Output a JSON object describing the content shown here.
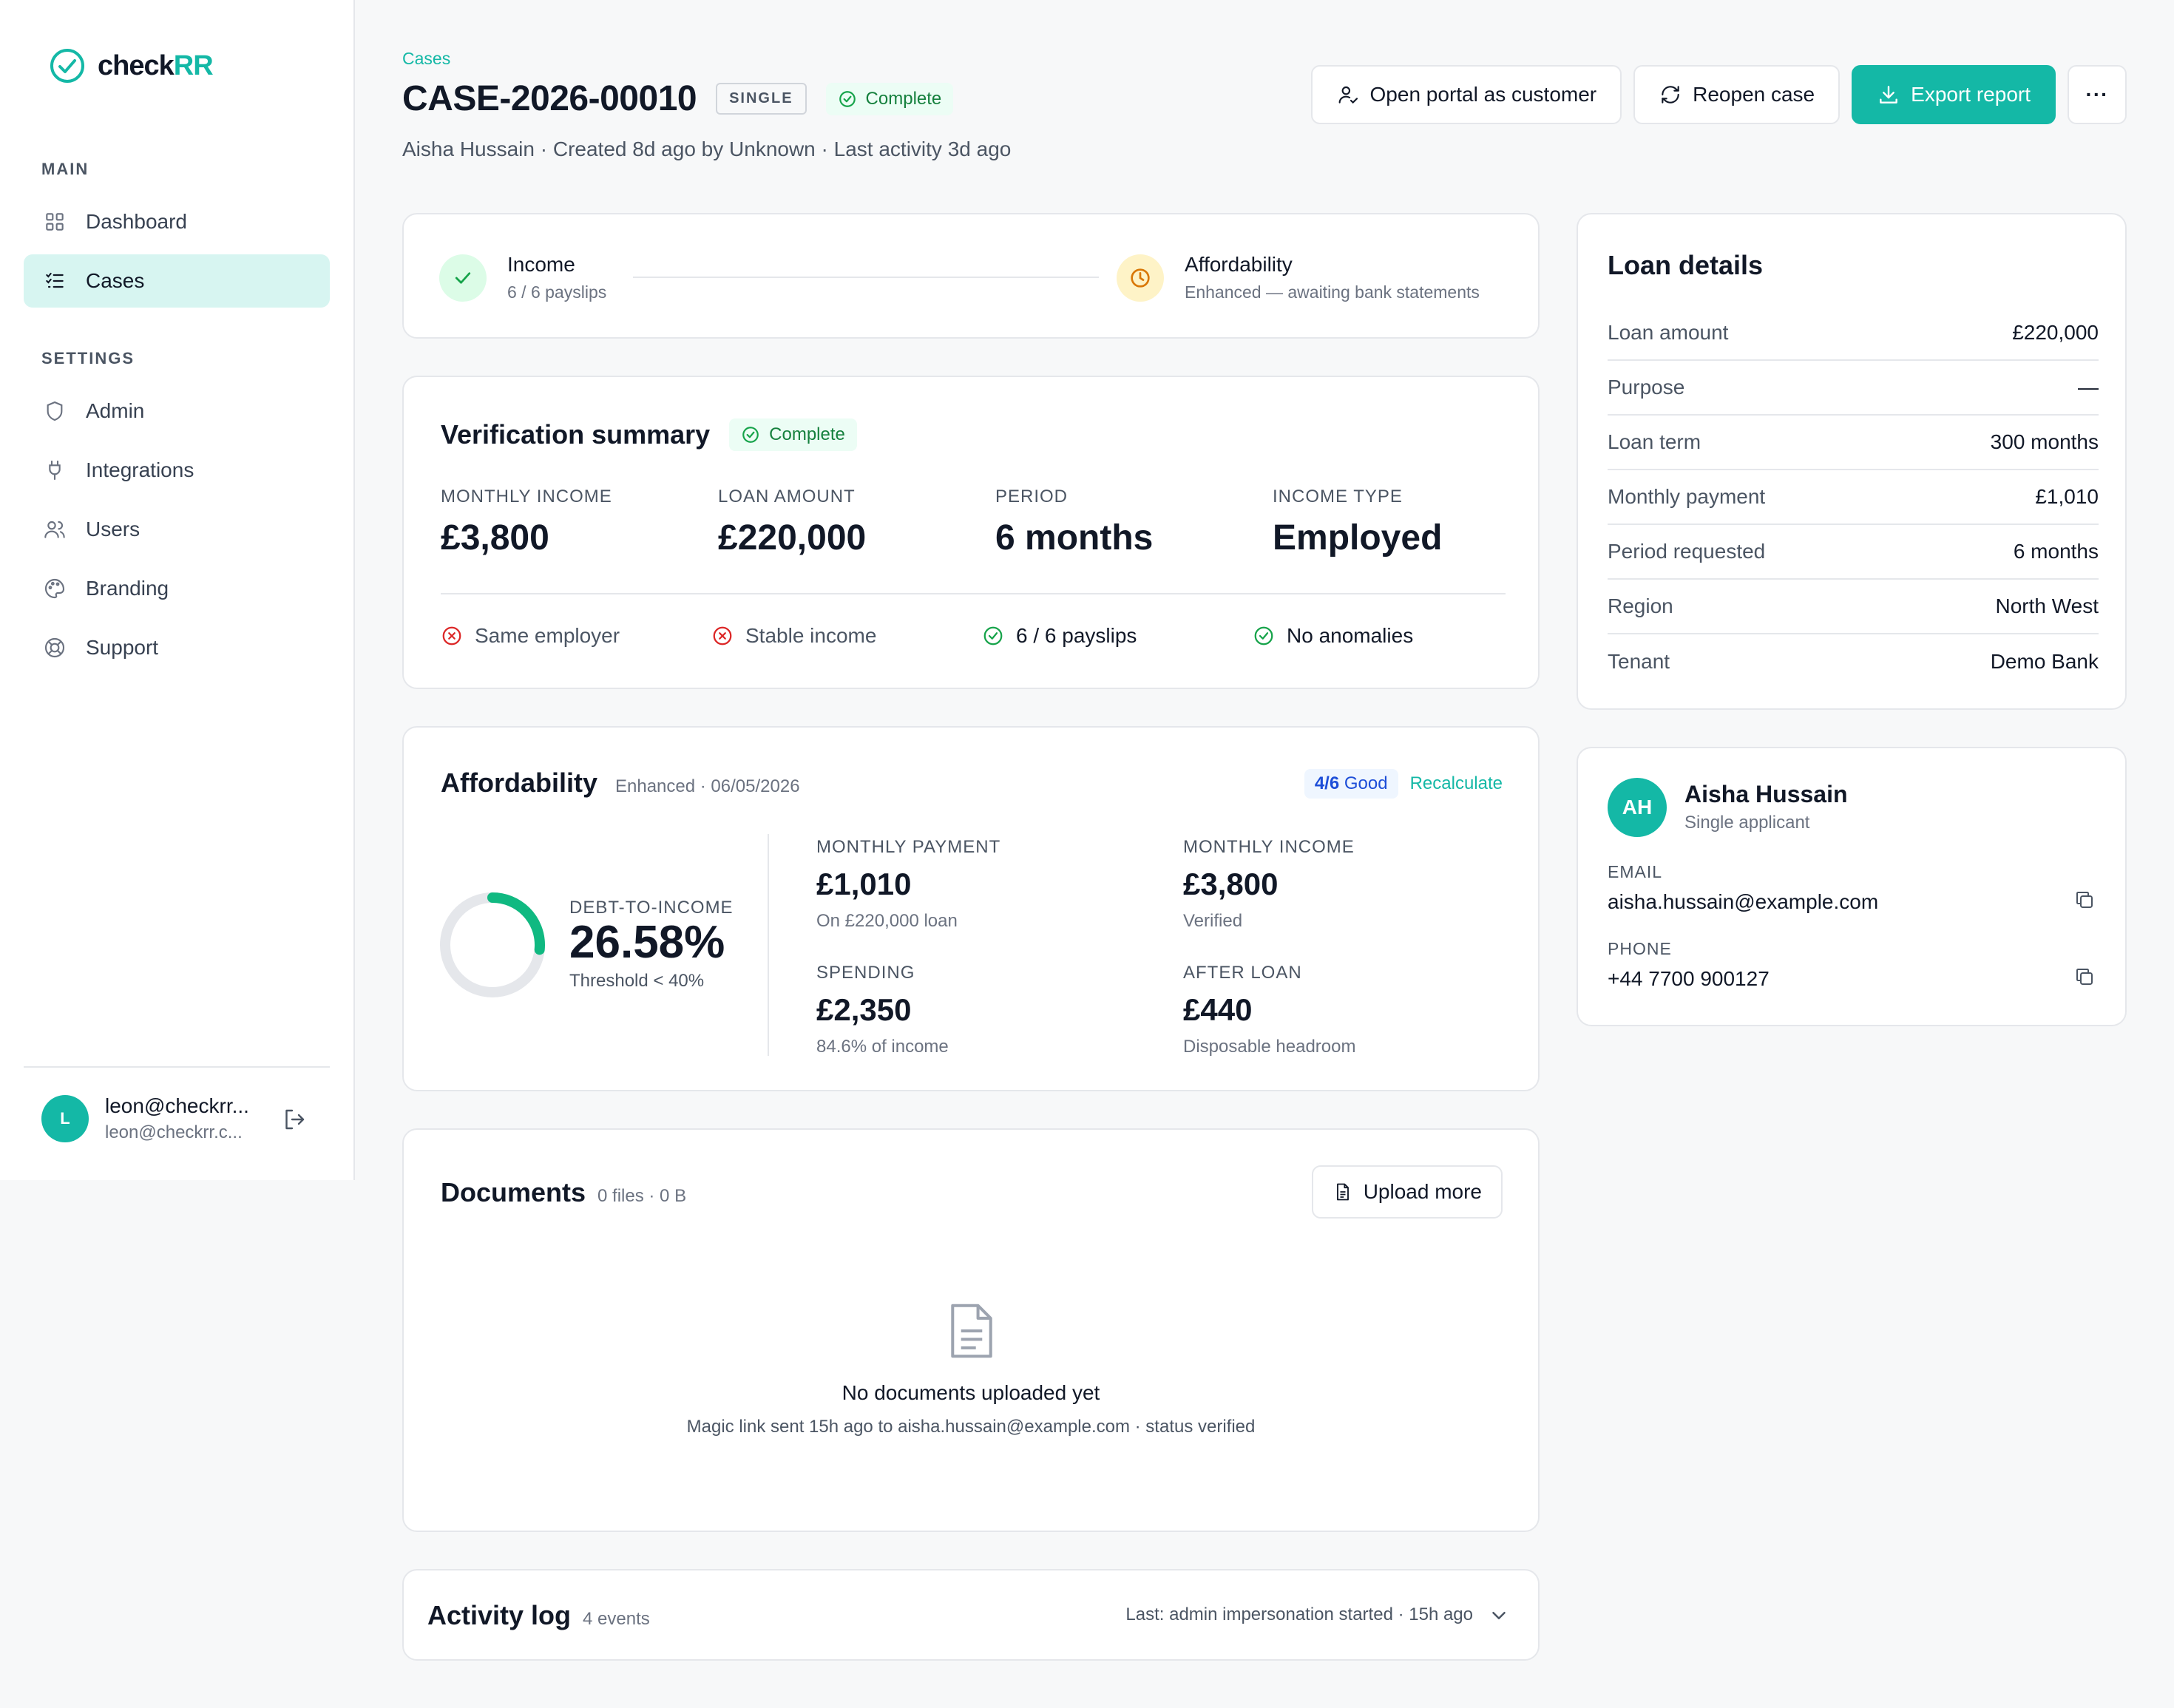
{
  "app": {
    "logo_main": "check",
    "logo_accent": "RR"
  },
  "sidebar": {
    "section_main": "MAIN",
    "section_settings": "SETTINGS",
    "items": [
      {
        "label": "Dashboard",
        "icon": "grid-icon"
      },
      {
        "label": "Cases",
        "icon": "list-check-icon",
        "active": true
      },
      {
        "label": "Admin",
        "icon": "shield-icon"
      },
      {
        "label": "Integrations",
        "icon": "plug-icon"
      },
      {
        "label": "Users",
        "icon": "users-icon"
      },
      {
        "label": "Branding",
        "icon": "palette-icon"
      },
      {
        "label": "Support",
        "icon": "lifebuoy-icon"
      }
    ],
    "user": {
      "initial": "L",
      "name": "leon@checkrr...",
      "email": "leon@checkrr.c..."
    }
  },
  "header": {
    "breadcrumb": "Cases",
    "title": "CASE-2026-00010",
    "tag": "SINGLE",
    "status": "Complete",
    "subline": "Aisha Hussain · Created 8d ago by Unknown · Last activity 3d ago",
    "actions": {
      "portal": "Open portal as customer",
      "reopen": "Reopen case",
      "export": "Export report",
      "more": "···"
    }
  },
  "steps": {
    "income_title": "Income",
    "income_sub": "6 / 6 payslips",
    "afford_title": "Affordability",
    "afford_sub": "Enhanced — awaiting bank statements"
  },
  "verification": {
    "title": "Verification summary",
    "status": "Complete",
    "stats": [
      {
        "label": "MONTHLY INCOME",
        "value": "£3,800"
      },
      {
        "label": "LOAN AMOUNT",
        "value": "£220,000"
      },
      {
        "label": "PERIOD",
        "value": "6 months"
      },
      {
        "label": "INCOME TYPE",
        "value": "Employed"
      }
    ],
    "checks": [
      {
        "label": "Same employer",
        "ok": false
      },
      {
        "label": "Stable income",
        "ok": false
      },
      {
        "label": "6 / 6 payslips",
        "ok": true
      },
      {
        "label": "No anomalies",
        "ok": true
      }
    ]
  },
  "affordability": {
    "title": "Affordability",
    "meta": "Enhanced · 06/05/2026",
    "score": "4/6",
    "score_label": "Good",
    "recalc": "Recalculate",
    "dti_label": "DEBT-TO-INCOME",
    "dti_value": "26.58%",
    "dti_fraction": 0.2658,
    "dti_threshold": "Threshold < 40%",
    "stats": [
      {
        "label": "MONTHLY PAYMENT",
        "value": "£1,010",
        "sub": "On £220,000 loan"
      },
      {
        "label": "MONTHLY INCOME",
        "value": "£3,800",
        "sub": "Verified"
      },
      {
        "label": "SPENDING",
        "value": "£2,350",
        "sub": "84.6% of income"
      },
      {
        "label": "AFTER LOAN",
        "value": "£440",
        "sub": "Disposable headroom"
      }
    ]
  },
  "documents": {
    "title": "Documents",
    "meta": "0 files · 0 B",
    "upload": "Upload more",
    "empty_title": "No documents uploaded yet",
    "empty_sub": "Magic link sent 15h ago to aisha.hussain@example.com · status verified"
  },
  "activity": {
    "title": "Activity log",
    "count": "4 events",
    "last": "Last: admin impersonation started · 15h ago"
  },
  "loan": {
    "title": "Loan details",
    "rows": [
      {
        "k": "Loan amount",
        "v": "£220,000"
      },
      {
        "k": "Purpose",
        "v": "—"
      },
      {
        "k": "Loan term",
        "v": "300 months"
      },
      {
        "k": "Monthly payment",
        "v": "£1,010"
      },
      {
        "k": "Period requested",
        "v": "6 months"
      },
      {
        "k": "Region",
        "v": "North West"
      },
      {
        "k": "Tenant",
        "v": "Demo Bank"
      }
    ]
  },
  "applicant": {
    "initials": "AH",
    "name": "Aisha Hussain",
    "role": "Single applicant",
    "email_label": "EMAIL",
    "email": "aisha.hussain@example.com",
    "phone_label": "PHONE",
    "phone": "+44 7700 900127"
  },
  "colors": {
    "accent": "#14b8a6",
    "success": "#16a34a",
    "danger": "#dc2626",
    "warning": "#d97706"
  }
}
